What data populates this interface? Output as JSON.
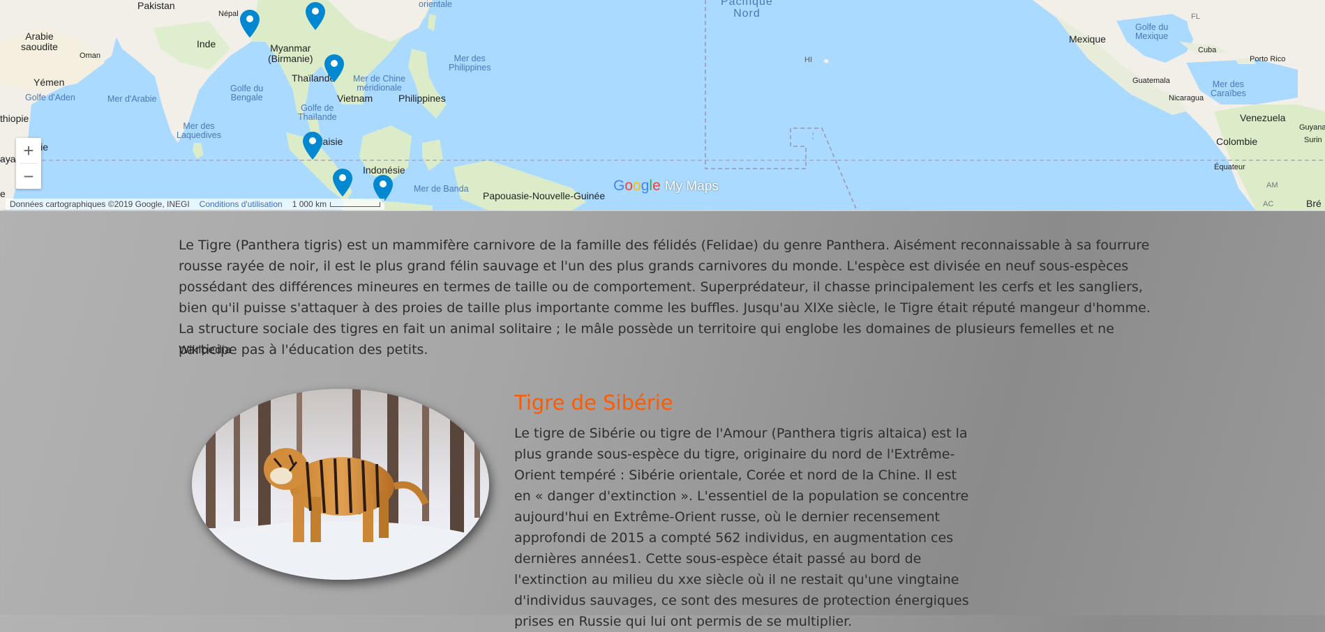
{
  "map": {
    "labels": {
      "pakistan": "Pakistan",
      "nepal": "Népal",
      "arabie": "Arabie\nsaoudite",
      "inde": "Inde",
      "oman": "Oman",
      "myanmar": "Myanmar\n(Birmanie)",
      "yemen": "Yémen",
      "thailande": "Thaïlande",
      "vietnam": "Vietnam",
      "philippines": "Philippines",
      "malaisie": "Malaisie",
      "indonesie": "Indonésie",
      "papouasie": "Papouasie-Nouvelle-Guinée",
      "ethiopie": "thiopie",
      "kenya": "aya",
      "somalie": "lie",
      "mexique": "Mexique",
      "cuba": "Cuba",
      "porto_rico": "Porto Rico",
      "guatemala": "Guatemala",
      "nicaragua": "Nicaragua",
      "venezuela": "Venezuela",
      "colombie": "Colombie",
      "equateur": "Équateur",
      "guyana": "Guyana",
      "surinam": "Surin",
      "bresil": "Bré",
      "hi": "HI",
      "fl": "FL",
      "am": "AM",
      "ac": "AC",
      "chine_orientale": "orientale",
      "e_letter": "e"
    },
    "seas": {
      "golfe_aden": "Golfe d'Aden",
      "mer_arabie": "Mer d'Arabie",
      "golfe_bengale": "Golfe du\nBengale",
      "mer_chine_merid": "Mer de Chine\nméridionale",
      "mer_philippines": "Mer des\nPhilippines",
      "golfe_thailande": "Golfe de\nThaïlande",
      "mer_laquedives": "Mer des\nLaquedives",
      "mer_banda": "Mer de Banda",
      "pacifique_nord": "Pacifique\nNord",
      "golfe_mexique": "Golfe du\nMexique",
      "mer_caraibes": "Mer des\nCaraïbes"
    },
    "attribution": "Données cartographiques ©2019 Google, INEGI",
    "terms_link": "Conditions d'utilisation",
    "scale": "1 000 km",
    "logo_my_maps": "My Maps",
    "zoom_in": "+",
    "zoom_out": "−",
    "colors": {
      "water": "#aadaff",
      "land": "#f2efe9",
      "vegetation": "#cfe6c0",
      "pin": "#0288d1"
    }
  },
  "intro": {
    "text": "Le Tigre (Panthera tigris) est un mammifère carnivore de la famille des félidés (Felidae) du genre Panthera. Aisément reconnaissable à sa fourrure rousse rayée de noir, il est le plus grand félin sauvage et l'un des plus grands carnivores du monde. L'espèce est divisée en neuf sous-espèces possédant des différences mineures en termes de taille ou de comportement. Superprédateur, il chasse principalement les cerfs et les sangliers, bien qu'il puisse s'attaquer à des proies de taille plus importante comme les buffles. Jusqu'au XIXe siècle, le Tigre était réputé mangeur d'homme. La structure sociale des tigres en fait un animal solitaire ; le mâle possède un territoire qui englobe les domaines de plusieurs femelles et ne participe pas à l'éducation des petits.",
    "source": "Wikipedia"
  },
  "section": {
    "title": "Tigre de Sibérie",
    "text": "Le tigre de Sibérie ou tigre de l'Amour (Panthera tigris altaica) est la plus grande sous-espèce du tigre, originaire du nord de l'Extrême-Orient tempéré : Sibérie orientale, Corée et nord de la Chine. Il est en « danger d'extinction ». L'essentiel de la population se concentre aujourd'hui en Extrême-Orient russe, où le dernier recensement approfondi de 2015 a compté 562 individus, en augmentation ces dernières années1. Cette sous-espèce était passé au bord de l'extinction au milieu du xxe siècle où il ne restait qu'une vingtaine d'individus sauvages, ce sont des mesures de protection énergiques prises en Russie qui lui ont permis de se multiplier.",
    "title_color": "#ff5a00"
  }
}
